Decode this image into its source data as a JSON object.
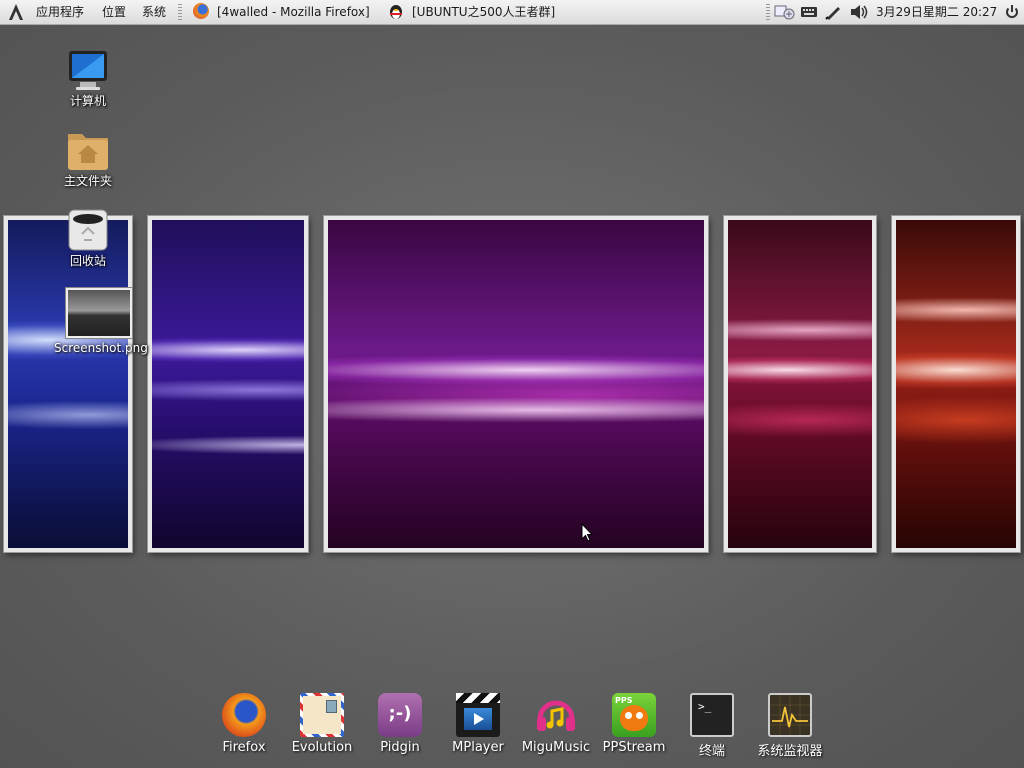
{
  "top_panel": {
    "menus": [
      "应用程序",
      "位置",
      "系统"
    ],
    "windows": [
      {
        "title": "[4walled - Mozilla Firefox]",
        "icon": "firefox-icon"
      },
      {
        "title": "[UBUNTU之500人王者群]",
        "icon": "qq-penguin-icon"
      }
    ],
    "clock": "3月29日星期二 20:27",
    "tray_icons": [
      "network-icon",
      "keyboard-icon",
      "pen-tablet-icon",
      "volume-icon",
      "power-icon"
    ]
  },
  "desktop_icons": [
    {
      "label": "计算机",
      "icon": "computer-icon"
    },
    {
      "label": "主文件夹",
      "icon": "home-folder-icon"
    },
    {
      "label": "回收站",
      "icon": "trash-icon"
    },
    {
      "label": "Screenshot.png",
      "icon": "image-thumbnail-icon"
    }
  ],
  "dock": [
    {
      "label": "Firefox",
      "icon": "firefox-icon"
    },
    {
      "label": "Evolution",
      "icon": "mail-icon"
    },
    {
      "label": "Pidgin",
      "icon": "chat-bubble-icon"
    },
    {
      "label": "MPlayer",
      "icon": "clapperboard-icon"
    },
    {
      "label": "MiguMusic",
      "icon": "headphones-music-icon"
    },
    {
      "label": "PPStream",
      "icon": "ppstream-icon"
    },
    {
      "label": "终端",
      "icon": "terminal-icon"
    },
    {
      "label": "系统监视器",
      "icon": "system-monitor-icon"
    }
  ],
  "colors": {
    "panel_bg": "#e6e6e6",
    "wall_blue": "#1a1f8a",
    "wall_violet": "#4a137a",
    "wall_purple": "#5a0b5a",
    "wall_crimson": "#6e0c2a",
    "wall_red": "#7a1410"
  }
}
